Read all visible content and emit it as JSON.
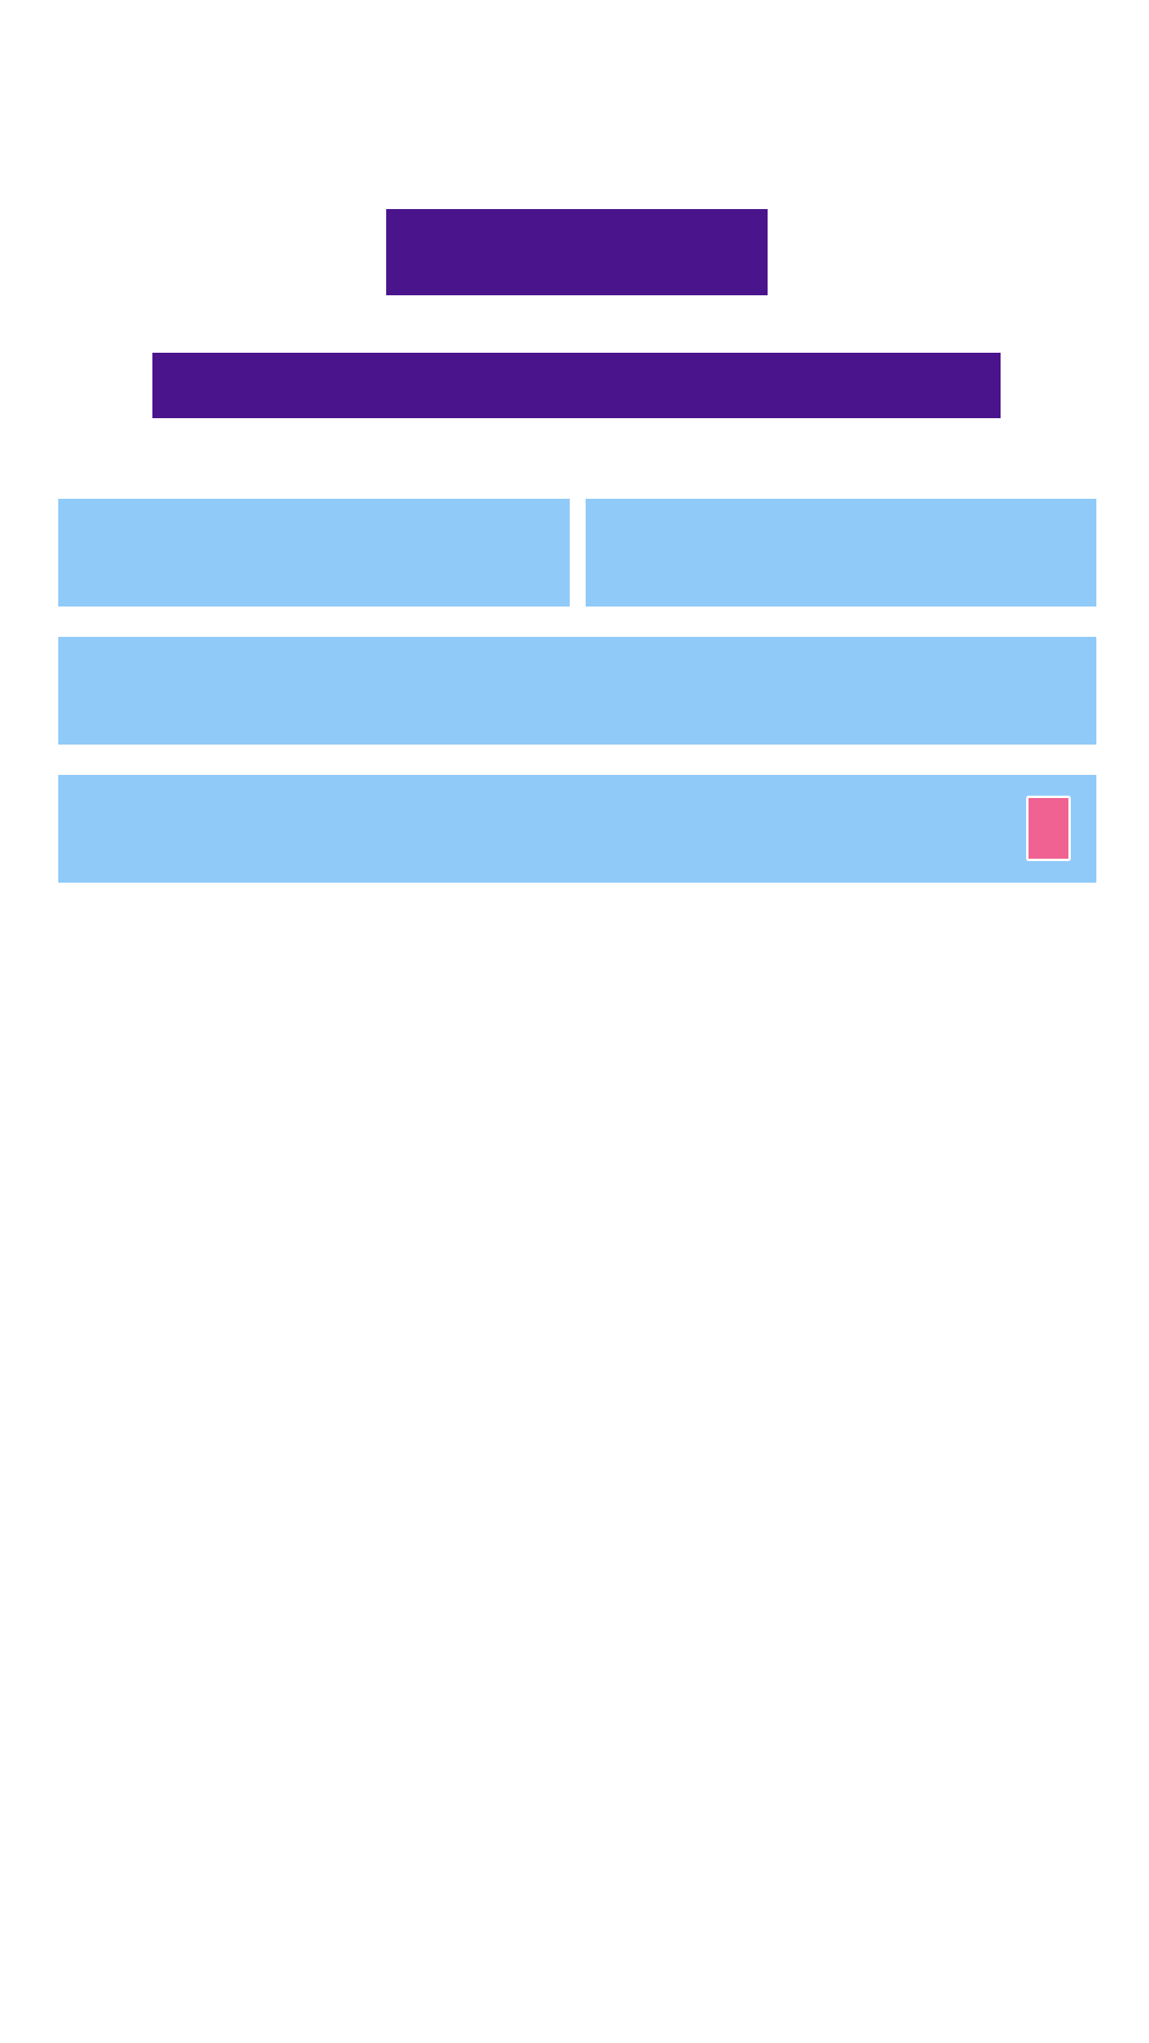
{
  "colors": {
    "header_block": "#4a148c",
    "field_background": "#90caf9",
    "accent_button": "#f06292",
    "page_background": "#ffffff"
  }
}
